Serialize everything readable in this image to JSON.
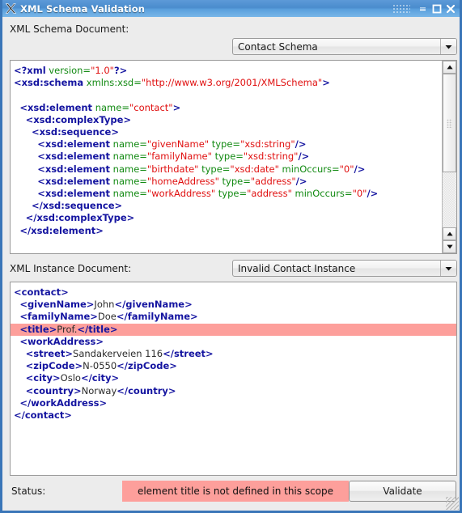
{
  "window": {
    "title": "XML Schema Validation",
    "logo_icon": "x-logo-icon",
    "controls": {
      "grip_icon": "window-grip-icon",
      "minimize_icon": "minimize-icon",
      "maximize_icon": "maximize-icon",
      "close_icon": "close-icon"
    }
  },
  "schema_section": {
    "label": "XML Schema Document:",
    "selected": "Contact Schema",
    "dropdown_icon": "chevron-down-icon",
    "scrollbar": {
      "up_icon": "scroll-up-icon",
      "down_icon": "scroll-down-icon",
      "thumb_icon": "scroll-thumb-grip"
    },
    "code_lines": [
      {
        "indent": 0,
        "parts": [
          {
            "t": "tag",
            "s": "<?xml"
          },
          {
            "t": "attr",
            "s": " version="
          },
          {
            "t": "val",
            "s": "\"1.0\""
          },
          {
            "t": "tag",
            "s": "?>"
          }
        ]
      },
      {
        "indent": 0,
        "parts": [
          {
            "t": "tag",
            "s": "<xsd:schema"
          },
          {
            "t": "attr",
            "s": " xmlns:xsd="
          },
          {
            "t": "val",
            "s": "\"http://www.w3.org/2001/XMLSchema\""
          },
          {
            "t": "tag",
            "s": ">"
          }
        ]
      },
      {
        "indent": 0,
        "parts": []
      },
      {
        "indent": 2,
        "parts": [
          {
            "t": "tag",
            "s": "<xsd:element"
          },
          {
            "t": "attr",
            "s": " name="
          },
          {
            "t": "val",
            "s": "\"contact\""
          },
          {
            "t": "tag",
            "s": ">"
          }
        ]
      },
      {
        "indent": 4,
        "parts": [
          {
            "t": "tag",
            "s": "<xsd:complexType>"
          }
        ]
      },
      {
        "indent": 6,
        "parts": [
          {
            "t": "tag",
            "s": "<xsd:sequence>"
          }
        ]
      },
      {
        "indent": 8,
        "parts": [
          {
            "t": "tag",
            "s": "<xsd:element"
          },
          {
            "t": "attr",
            "s": " name="
          },
          {
            "t": "val",
            "s": "\"givenName\""
          },
          {
            "t": "attr",
            "s": " type="
          },
          {
            "t": "val",
            "s": "\"xsd:string\""
          },
          {
            "t": "tag",
            "s": "/>"
          }
        ]
      },
      {
        "indent": 8,
        "parts": [
          {
            "t": "tag",
            "s": "<xsd:element"
          },
          {
            "t": "attr",
            "s": " name="
          },
          {
            "t": "val",
            "s": "\"familyName\""
          },
          {
            "t": "attr",
            "s": " type="
          },
          {
            "t": "val",
            "s": "\"xsd:string\""
          },
          {
            "t": "tag",
            "s": "/>"
          }
        ]
      },
      {
        "indent": 8,
        "parts": [
          {
            "t": "tag",
            "s": "<xsd:element"
          },
          {
            "t": "attr",
            "s": " name="
          },
          {
            "t": "val",
            "s": "\"birthdate\""
          },
          {
            "t": "attr",
            "s": " type="
          },
          {
            "t": "val",
            "s": "\"xsd:date\""
          },
          {
            "t": "attr",
            "s": " minOccurs="
          },
          {
            "t": "val",
            "s": "\"0\""
          },
          {
            "t": "tag",
            "s": "/>"
          }
        ]
      },
      {
        "indent": 8,
        "parts": [
          {
            "t": "tag",
            "s": "<xsd:element"
          },
          {
            "t": "attr",
            "s": " name="
          },
          {
            "t": "val",
            "s": "\"homeAddress\""
          },
          {
            "t": "attr",
            "s": " type="
          },
          {
            "t": "val",
            "s": "\"address\""
          },
          {
            "t": "tag",
            "s": "/>"
          }
        ]
      },
      {
        "indent": 8,
        "parts": [
          {
            "t": "tag",
            "s": "<xsd:element"
          },
          {
            "t": "attr",
            "s": " name="
          },
          {
            "t": "val",
            "s": "\"workAddress\""
          },
          {
            "t": "attr",
            "s": " type="
          },
          {
            "t": "val",
            "s": "\"address\""
          },
          {
            "t": "attr",
            "s": " minOccurs="
          },
          {
            "t": "val",
            "s": "\"0\""
          },
          {
            "t": "tag",
            "s": "/>"
          }
        ]
      },
      {
        "indent": 6,
        "parts": [
          {
            "t": "tag",
            "s": "</xsd:sequence>"
          }
        ]
      },
      {
        "indent": 4,
        "parts": [
          {
            "t": "tag",
            "s": "</xsd:complexType>"
          }
        ]
      },
      {
        "indent": 2,
        "parts": [
          {
            "t": "tag",
            "s": "</xsd:element>"
          }
        ]
      }
    ]
  },
  "instance_section": {
    "label": "XML Instance Document:",
    "selected": "Invalid Contact Instance",
    "dropdown_icon": "chevron-down-icon",
    "code_lines": [
      {
        "indent": 0,
        "highlight": false,
        "parts": [
          {
            "t": "tag",
            "s": "<contact>"
          }
        ]
      },
      {
        "indent": 2,
        "highlight": false,
        "parts": [
          {
            "t": "tag",
            "s": "<givenName>"
          },
          {
            "t": "txt",
            "s": "John"
          },
          {
            "t": "tag",
            "s": "</givenName>"
          }
        ]
      },
      {
        "indent": 2,
        "highlight": false,
        "parts": [
          {
            "t": "tag",
            "s": "<familyName>"
          },
          {
            "t": "txt",
            "s": "Doe"
          },
          {
            "t": "tag",
            "s": "</familyName>"
          }
        ]
      },
      {
        "indent": 2,
        "highlight": true,
        "parts": [
          {
            "t": "tag",
            "s": "<title>"
          },
          {
            "t": "txt",
            "s": "Prof."
          },
          {
            "t": "tag",
            "s": "</title>"
          }
        ]
      },
      {
        "indent": 2,
        "highlight": false,
        "parts": [
          {
            "t": "tag",
            "s": "<workAddress>"
          }
        ]
      },
      {
        "indent": 4,
        "highlight": false,
        "parts": [
          {
            "t": "tag",
            "s": "<street>"
          },
          {
            "t": "txt",
            "s": "Sandakerveien 116"
          },
          {
            "t": "tag",
            "s": "</street>"
          }
        ]
      },
      {
        "indent": 4,
        "highlight": false,
        "parts": [
          {
            "t": "tag",
            "s": "<zipCode>"
          },
          {
            "t": "txt",
            "s": "N-0550"
          },
          {
            "t": "tag",
            "s": "</zipCode>"
          }
        ]
      },
      {
        "indent": 4,
        "highlight": false,
        "parts": [
          {
            "t": "tag",
            "s": "<city>"
          },
          {
            "t": "txt",
            "s": "Oslo"
          },
          {
            "t": "tag",
            "s": "</city>"
          }
        ]
      },
      {
        "indent": 4,
        "highlight": false,
        "parts": [
          {
            "t": "tag",
            "s": "<country>"
          },
          {
            "t": "txt",
            "s": "Norway"
          },
          {
            "t": "tag",
            "s": "</country>"
          }
        ]
      },
      {
        "indent": 2,
        "highlight": false,
        "parts": [
          {
            "t": "tag",
            "s": "</workAddress>"
          }
        ]
      },
      {
        "indent": 0,
        "highlight": false,
        "parts": [
          {
            "t": "tag",
            "s": "</contact>"
          }
        ]
      }
    ]
  },
  "status": {
    "label": "Status:",
    "message": "element title is not defined in this scope",
    "message_bg": "#fd9f9b",
    "validate_label": "Validate"
  },
  "colors": {
    "window_border": "#3a76b8",
    "titlebar": "#4a8ccd",
    "tag": "#1414a0",
    "attribute": "#128a12",
    "value": "#e01010",
    "error_highlight": "#fd9f9b",
    "panel_bg": "#ececec"
  }
}
